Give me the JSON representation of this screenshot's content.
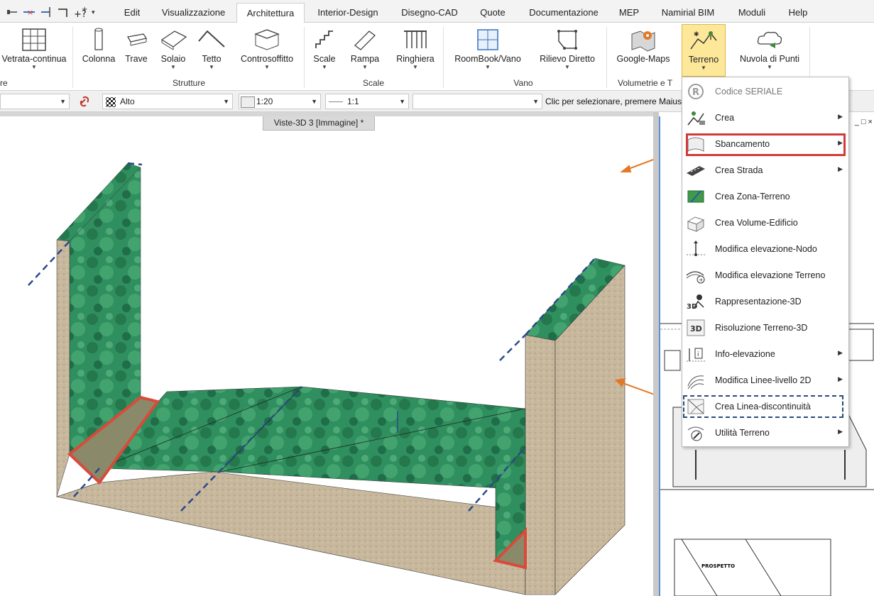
{
  "tabs": [
    "Edit",
    "Visualizzazione",
    "Architettura",
    "Interior-Design",
    "Disegno-CAD",
    "Quote",
    "Documentazione",
    "MEP",
    "Namirial BIM",
    "Moduli",
    "Help"
  ],
  "active_tab": "Architettura",
  "ribbon": {
    "buttons": {
      "vetrata": "Vetrata-continua",
      "colonna": "Colonna",
      "trave": "Trave",
      "solaio": "Solaio",
      "tetto": "Tetto",
      "controsoffitto": "Controsoffitto",
      "scale": "Scale",
      "rampa": "Rampa",
      "ringhiera": "Ringhiera",
      "roombook": "RoomBook/Vano",
      "rilievo": "Rilievo Diretto",
      "google_maps": "Google-Maps",
      "terreno": "Terreno",
      "nuvola": "Nuvola di Punti"
    },
    "groups": {
      "partial": "re",
      "strutture": "Strutture",
      "scale": "Scale",
      "vano": "Vano",
      "volumetrie": "Volumetrie e T"
    }
  },
  "optbar": {
    "layer_value": "Alto",
    "scale_value": "1:20",
    "ratio_value": "1:1",
    "text_value": "",
    "status": "Clic per selezionare, premere Maiusc"
  },
  "viewport": {
    "tab_label": "Viste-3D 3 [Immagine] *"
  },
  "right_panel": {
    "controls": "_ □ ×",
    "drawing_label": "PROSPETTO"
  },
  "dropdown": {
    "items": [
      {
        "label": "Codice SERIALE",
        "icon": "registered-icon",
        "submenu": false,
        "disabled": true
      },
      {
        "label": "Crea",
        "icon": "create-terrain-icon",
        "submenu": true,
        "disabled": false
      },
      {
        "label": "Sbancamento",
        "icon": "excavation-icon",
        "submenu": true,
        "disabled": false
      },
      {
        "label": "Crea Strada",
        "icon": "road-icon",
        "submenu": true,
        "disabled": false
      },
      {
        "label": "Crea Zona-Terreno",
        "icon": "terrain-zone-icon",
        "submenu": false,
        "disabled": false
      },
      {
        "label": "Crea Volume-Edificio",
        "icon": "building-volume-icon",
        "submenu": false,
        "disabled": false
      },
      {
        "label": "Modifica elevazione-Nodo",
        "icon": "node-elevation-icon",
        "submenu": false,
        "disabled": false
      },
      {
        "label": "Modifica elevazione Terreno",
        "icon": "terrain-elevation-icon",
        "submenu": false,
        "disabled": false
      },
      {
        "label": "Rappresentazione-3D",
        "icon": "representation-3d-icon",
        "submenu": false,
        "disabled": false
      },
      {
        "label": "Risoluzione Terreno-3D",
        "icon": "resolution-3d-icon",
        "submenu": false,
        "disabled": false
      },
      {
        "label": "Info-elevazione",
        "icon": "info-elevation-icon",
        "submenu": true,
        "disabled": false
      },
      {
        "label": "Modifica Linee-livello 2D",
        "icon": "contour-lines-icon",
        "submenu": true,
        "disabled": false
      },
      {
        "label": "Crea Linea-discontinuità",
        "icon": "break-line-icon",
        "submenu": false,
        "disabled": false
      },
      {
        "label": "Utilità Terreno",
        "icon": "terrain-utility-icon",
        "submenu": true,
        "disabled": false
      }
    ]
  }
}
